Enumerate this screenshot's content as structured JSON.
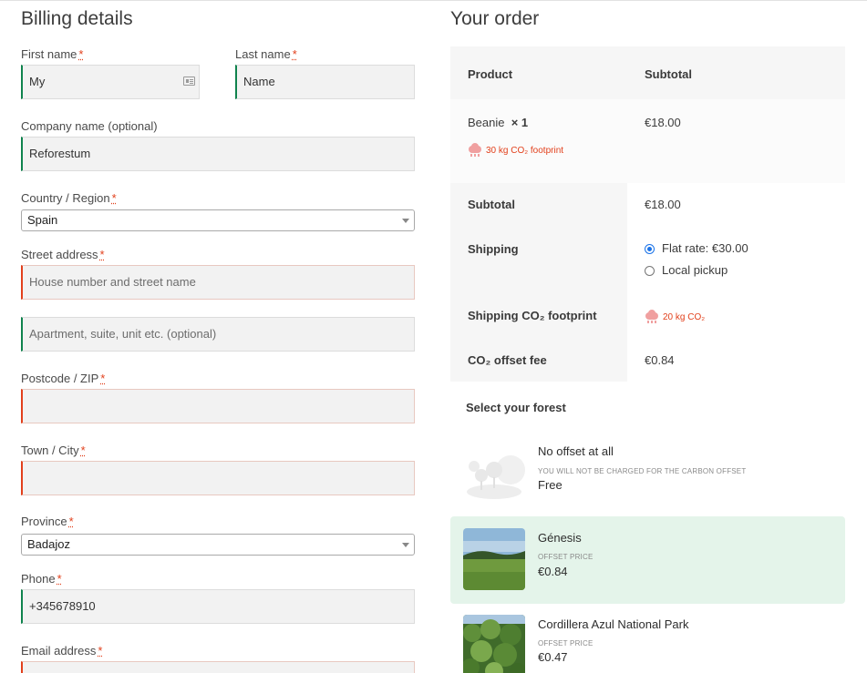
{
  "billing": {
    "title": "Billing details",
    "first_name": {
      "label": "First name",
      "req": "*",
      "value": "My"
    },
    "last_name": {
      "label": "Last name",
      "req": "*",
      "value": "Name"
    },
    "company": {
      "label": "Company name (optional)",
      "value": "Reforestum"
    },
    "country": {
      "label": "Country / Region",
      "req": "*",
      "value": "Spain"
    },
    "street": {
      "label": "Street address",
      "req": "*",
      "placeholder1": "House number and street name",
      "placeholder2": "Apartment, suite, unit etc. (optional)"
    },
    "postcode": {
      "label": "Postcode / ZIP",
      "req": "*"
    },
    "town": {
      "label": "Town / City",
      "req": "*"
    },
    "province": {
      "label": "Province",
      "req": "*",
      "value": "Badajoz"
    },
    "phone": {
      "label": "Phone",
      "req": "*",
      "value": "+345678910"
    },
    "email": {
      "label": "Email address",
      "req": "*"
    }
  },
  "order": {
    "title": "Your order",
    "head_product": "Product",
    "head_subtotal": "Subtotal",
    "item_name": "Beanie",
    "item_qty": "× 1",
    "item_price": "€18.00",
    "item_co2": "30 kg CO₂ footprint",
    "subtotal_label": "Subtotal",
    "subtotal_value": "€18.00",
    "shipping_label": "Shipping",
    "shipping_opt1": "Flat rate: €30.00",
    "shipping_opt2": "Local pickup",
    "shipping_co2_label": "Shipping CO₂ footprint",
    "shipping_co2_value": "20 kg CO₂",
    "offset_label": "CO₂ offset fee",
    "offset_value": "€0.84",
    "select_forest": "Select your forest"
  },
  "forests": [
    {
      "name": "No offset at all",
      "sub": "YOU WILL NOT BE CHARGED FOR THE CARBON OFFSET",
      "price": "Free"
    },
    {
      "name": "Génesis",
      "sub": "OFFSET PRICE",
      "price": "€0.84"
    },
    {
      "name": "Cordillera Azul National Park",
      "sub": "OFFSET PRICE",
      "price": "€0.47"
    }
  ],
  "colors": {
    "accent_green": "#0f834d",
    "error_red": "#e2401c",
    "selected_bg": "#e4f4ea"
  }
}
